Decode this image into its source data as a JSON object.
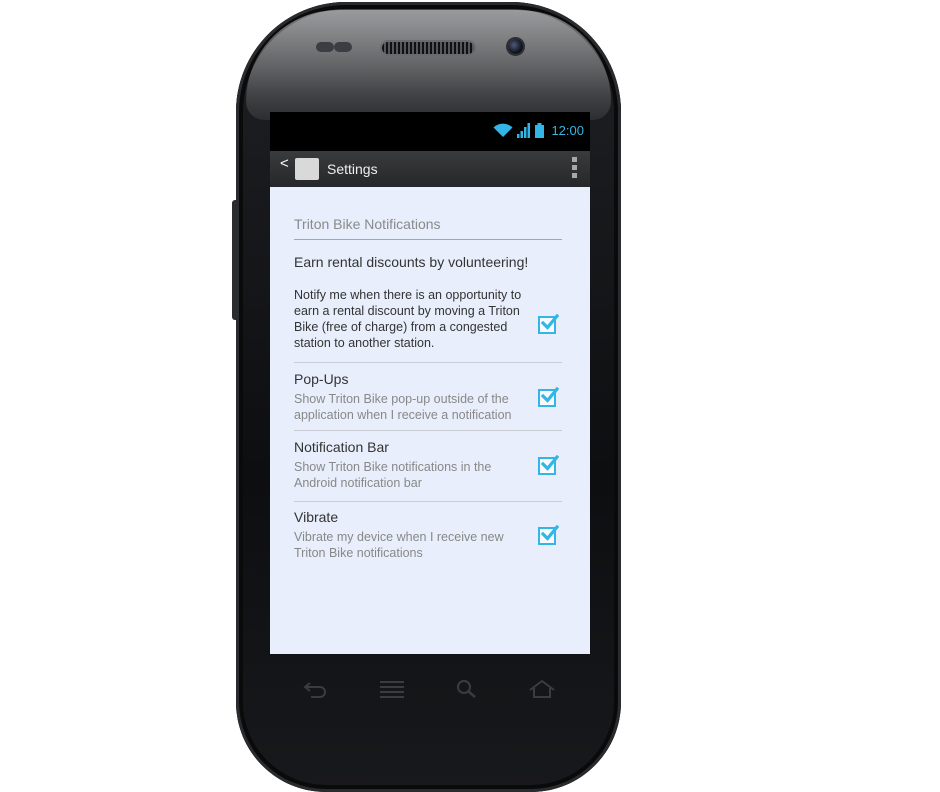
{
  "status_bar": {
    "time": "12:00",
    "icons": [
      "wifi-icon",
      "signal-icon",
      "battery-icon"
    ],
    "accent_color": "#33b5e5"
  },
  "action_bar": {
    "back": "<",
    "title": "Settings",
    "menu_icon": "overflow-menu-icon"
  },
  "settings": {
    "category": "Triton Bike Notifications",
    "intro": "Earn rental discounts by volunteering!",
    "items": [
      {
        "title": "",
        "summary": "Notify me when there is an opportunity to earn a rental discount by moving a Triton Bike (free of charge) from a congested station to another station.",
        "checked": true
      },
      {
        "title": "Pop-Ups",
        "summary": "Show Triton Bike pop-up outside of the application when I receive a notification",
        "checked": true
      },
      {
        "title": "Notification Bar",
        "summary": "Show Triton Bike notifications in the Android notification bar",
        "checked": true
      },
      {
        "title": "Vibrate",
        "summary": "Vibrate my device when I receive new Triton Bike notifications",
        "checked": true
      }
    ]
  },
  "nav_buttons": [
    "back-nav-icon",
    "menu-nav-icon",
    "search-nav-icon",
    "home-nav-icon"
  ]
}
